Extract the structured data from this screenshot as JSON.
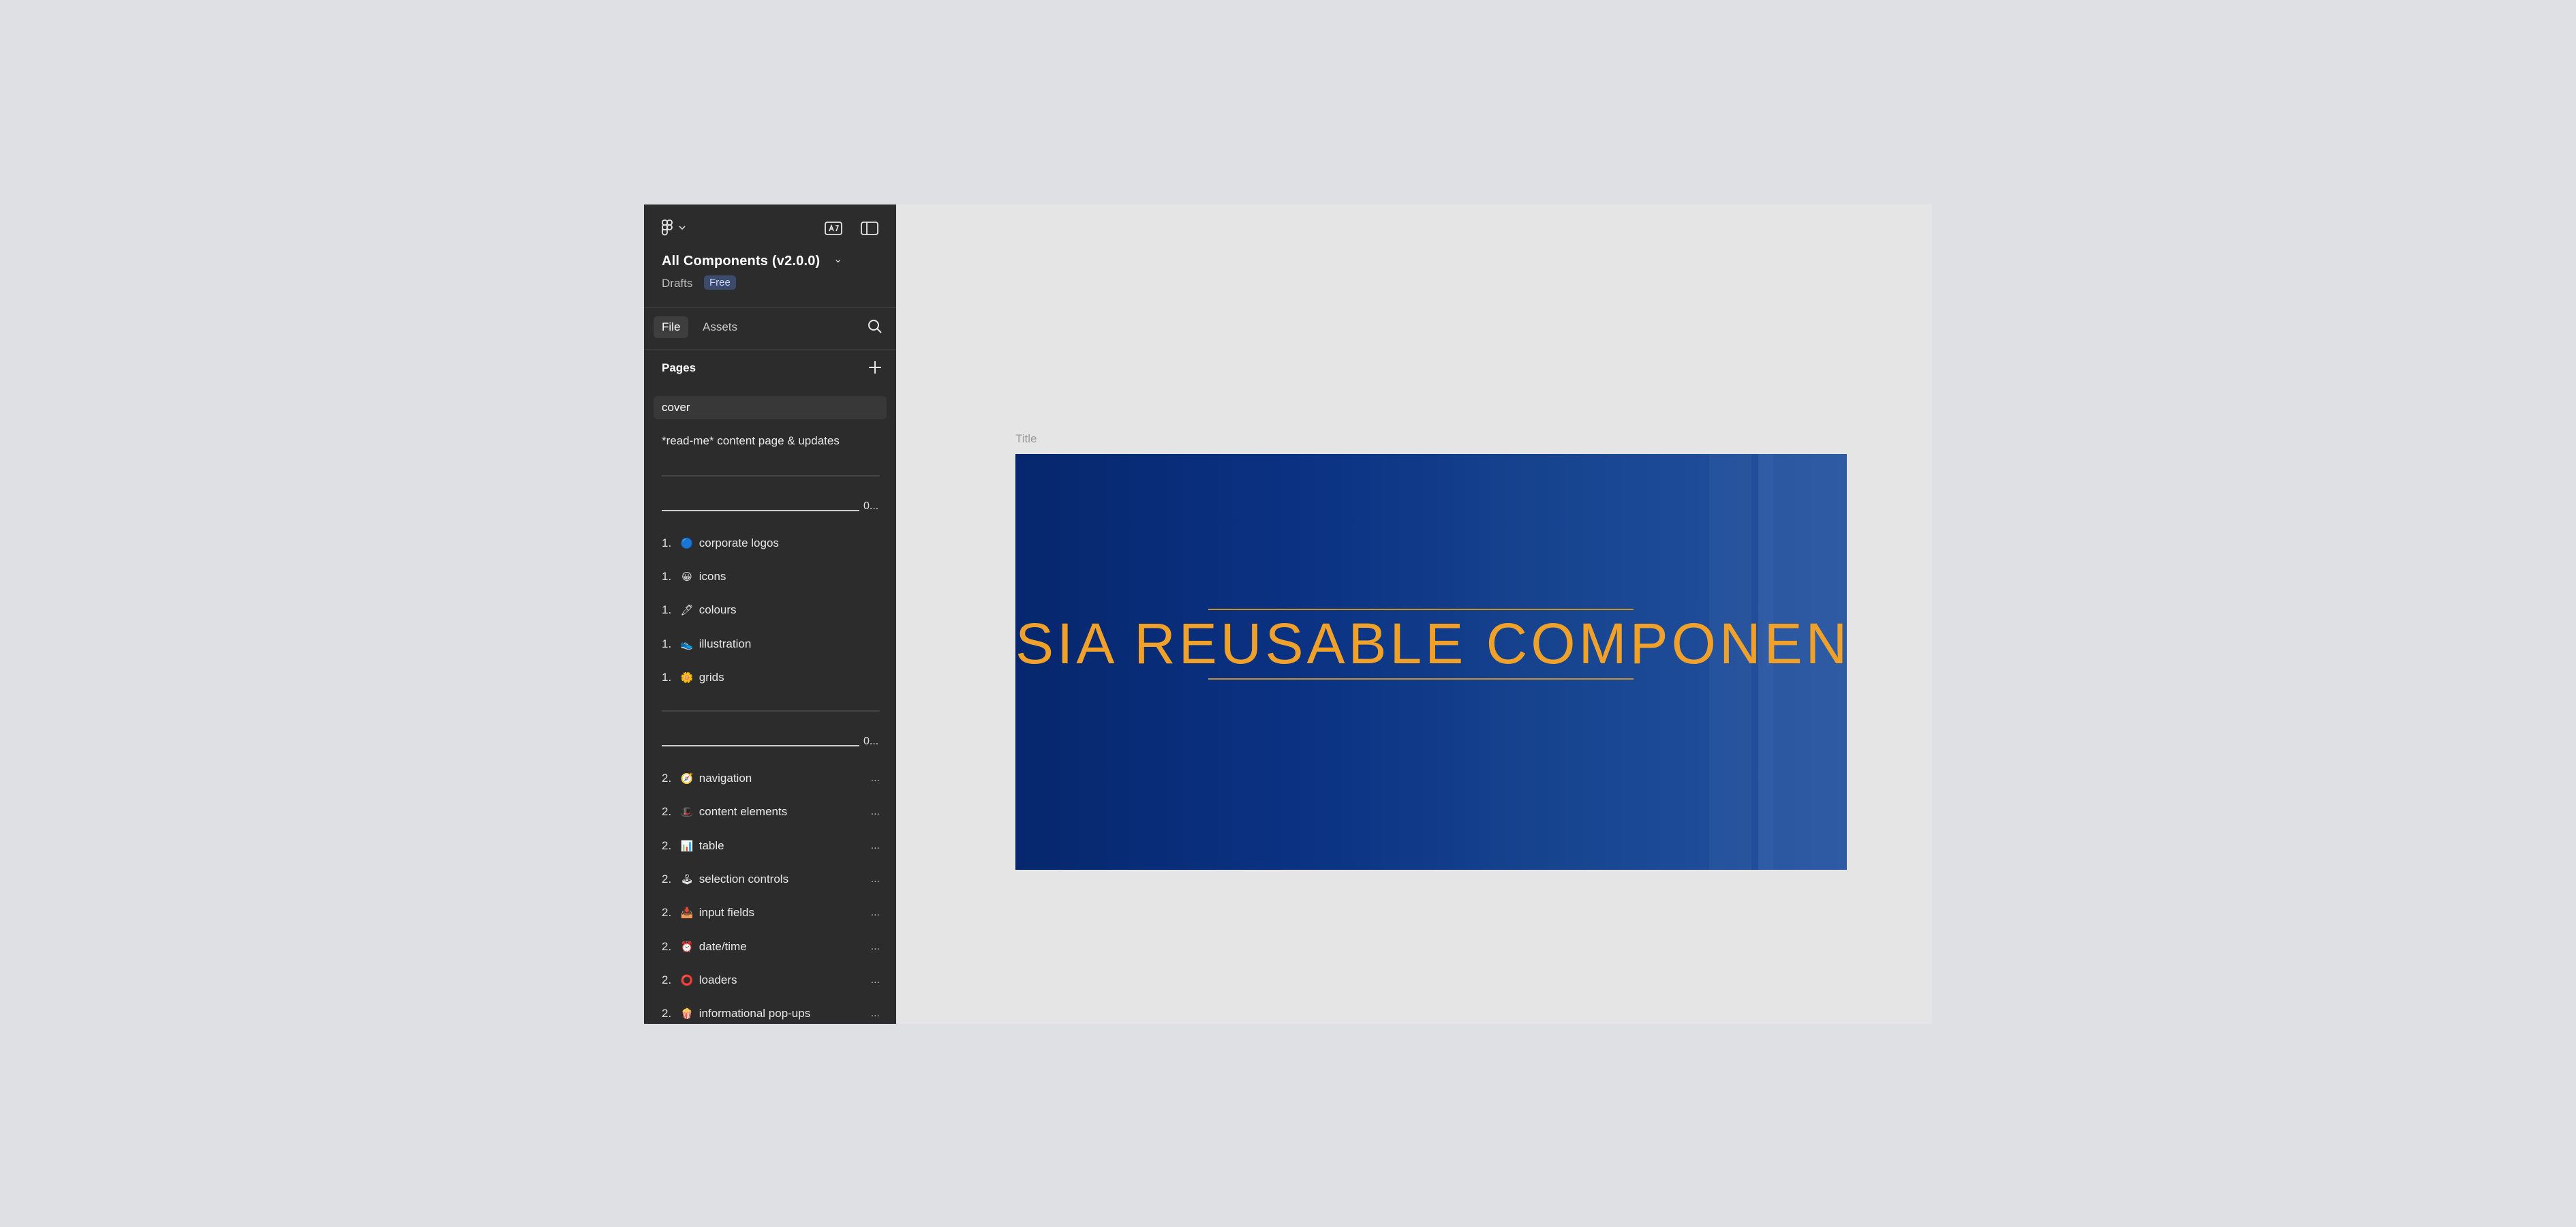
{
  "sidebar": {
    "file_title": "All Components (v2.0.0)",
    "location": "Drafts",
    "plan_badge": "Free",
    "tabs": [
      {
        "label": "File"
      },
      {
        "label": "Assets"
      }
    ],
    "pages_heading": "Pages",
    "pages": [
      {
        "label": "cover"
      },
      {
        "label": "*read-me* content page & updates"
      }
    ],
    "section_divider_1": "0...",
    "section1": [
      {
        "num": "1.",
        "emoji": "🔵",
        "label": "corporate logos"
      },
      {
        "num": "1.",
        "emoji": "😀",
        "label": "icons"
      },
      {
        "num": "1.",
        "emoji": "🖊",
        "label": "colours"
      },
      {
        "num": "1.",
        "emoji": "👟",
        "label": "illustration"
      },
      {
        "num": "1.",
        "emoji": "🌼",
        "label": "grids"
      }
    ],
    "section_divider_2": "0...",
    "section2": [
      {
        "num": "2.",
        "emoji": "🧭",
        "label": "navigation",
        "more": "..."
      },
      {
        "num": "2.",
        "emoji": "🎩",
        "label": "content elements",
        "more": "..."
      },
      {
        "num": "2.",
        "emoji": "📊",
        "label": "table",
        "more": "..."
      },
      {
        "num": "2.",
        "emoji": "🕹",
        "label": "selection controls",
        "more": "..."
      },
      {
        "num": "2.",
        "emoji": "📥",
        "label": "input fields",
        "more": "..."
      },
      {
        "num": "2.",
        "emoji": "⏰",
        "label": "date/time",
        "more": "..."
      },
      {
        "num": "2.",
        "emoji": "⭕",
        "label": "loaders",
        "more": "..."
      },
      {
        "num": "2.",
        "emoji": "🍿",
        "label": "informational pop-ups",
        "more": "..."
      }
    ]
  },
  "canvas": {
    "frame_label": "Title",
    "cover_title": "SIA REUSABLE COMPONENTS"
  },
  "colors": {
    "sidebar_bg": "#2c2c2c",
    "canvas_bg": "#e5e5e5",
    "cover_bg": "#0b3283",
    "cover_text": "#f0a12a",
    "badge_bg": "#3c4b6b"
  },
  "icons": {
    "menu": "figma-logo-icon",
    "ai": "ai-assistant-icon",
    "panel": "sidebar-toggle-icon",
    "search": "search-icon",
    "add": "plus-icon"
  }
}
